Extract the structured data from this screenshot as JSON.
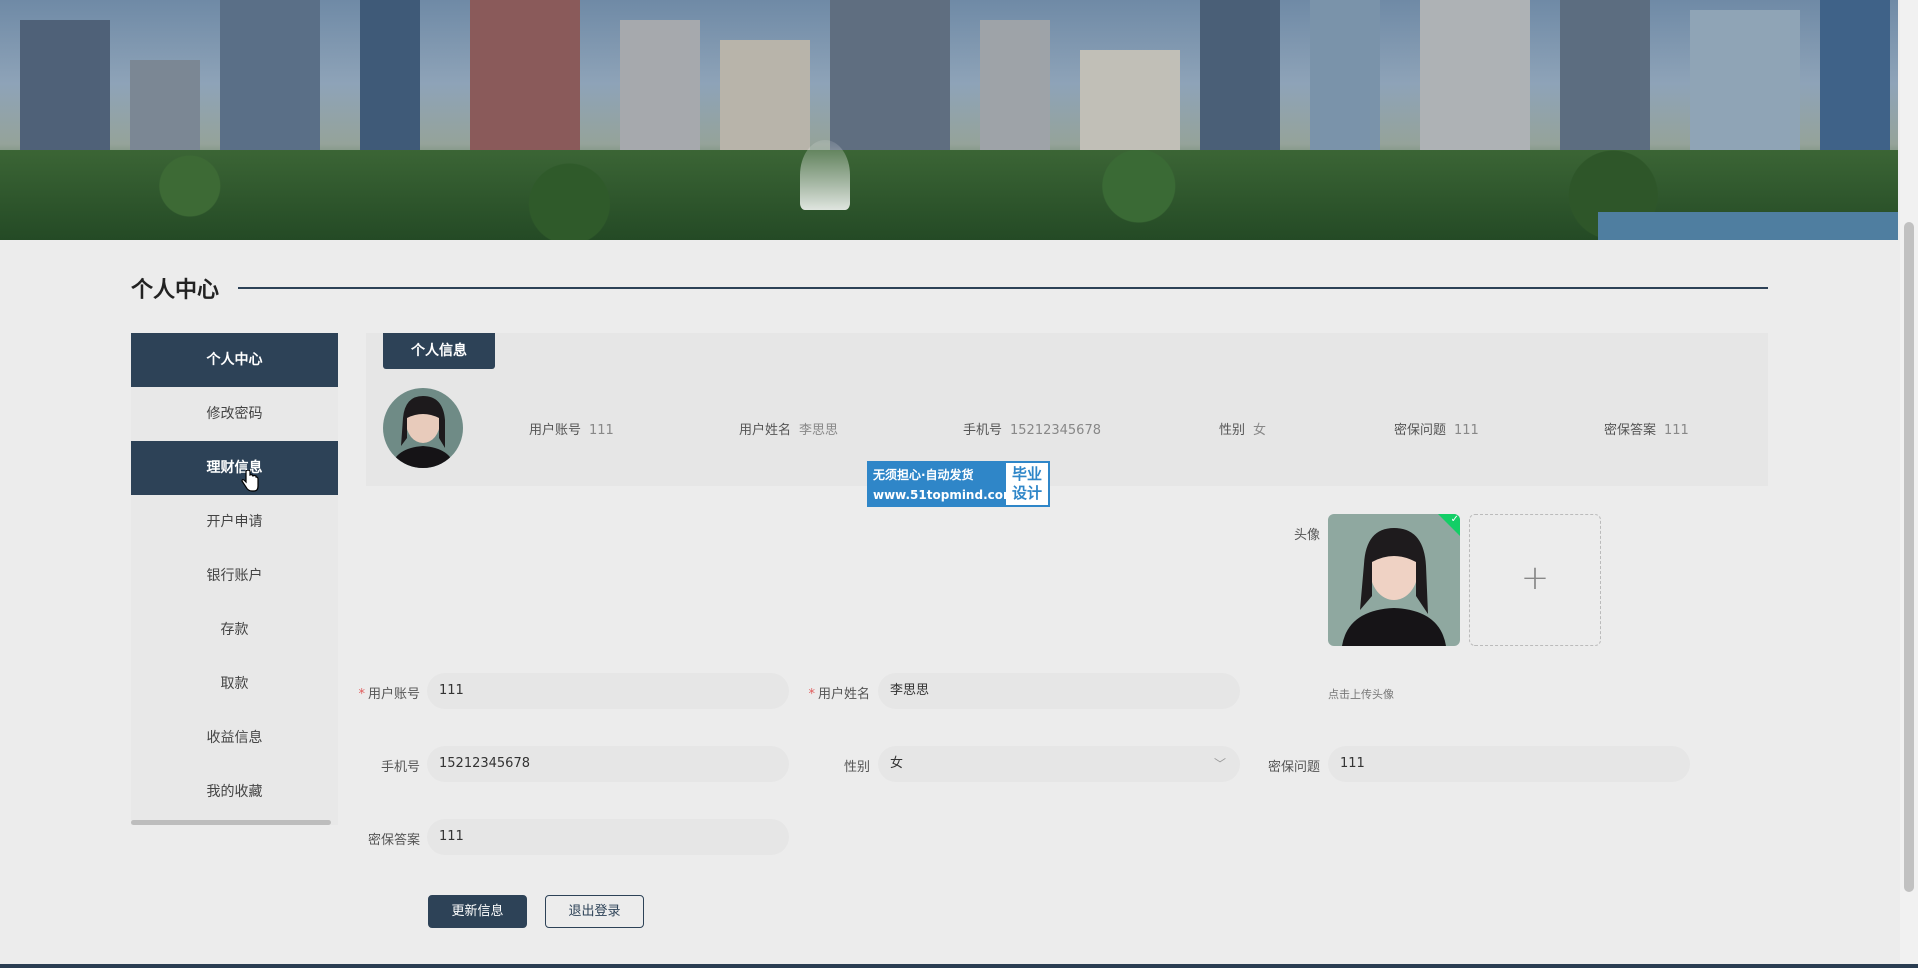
{
  "section_title": "个人中心",
  "sidebar": {
    "items": [
      {
        "label": "个人中心",
        "active": true
      },
      {
        "label": "修改密码",
        "active": false
      },
      {
        "label": "理财信息",
        "active": true
      },
      {
        "label": "开户申请",
        "active": false
      },
      {
        "label": "银行账户",
        "active": false
      },
      {
        "label": "存款",
        "active": false
      },
      {
        "label": "取款",
        "active": false
      },
      {
        "label": "收益信息",
        "active": false
      },
      {
        "label": "我的收藏",
        "active": false
      }
    ]
  },
  "info": {
    "tab_label": "个人信息",
    "fields": [
      {
        "label": "用户账号",
        "value": "111"
      },
      {
        "label": "用户姓名",
        "value": "李思思"
      },
      {
        "label": "手机号",
        "value": "15212345678"
      },
      {
        "label": "性别",
        "value": "女"
      },
      {
        "label": "密保问题",
        "value": "111"
      },
      {
        "label": "密保答案",
        "value": "111"
      }
    ]
  },
  "watermark": {
    "line1": "无须担心·自动发货",
    "line2": "www.51topmind.com",
    "right1": "毕业",
    "right2": "设计"
  },
  "form": {
    "avatar_label": "头像",
    "upload_tip": "点击上传头像",
    "upload_plus": "+",
    "account_label": "用户账号",
    "account_value": "111",
    "name_label": "用户姓名",
    "name_value": "李思思",
    "phone_label": "手机号",
    "phone_value": "15212345678",
    "gender_label": "性别",
    "gender_value": "女",
    "question_label": "密保问题",
    "question_value": "111",
    "answer_label": "密保答案",
    "answer_value": "111",
    "required_mark": "*"
  },
  "buttons": {
    "update": "更新信息",
    "logout": "退出登录"
  },
  "colors": {
    "primary": "#2d4257",
    "required": "#e05a5a",
    "watermark": "#2f86c8",
    "upload_success": "#13ce66"
  }
}
